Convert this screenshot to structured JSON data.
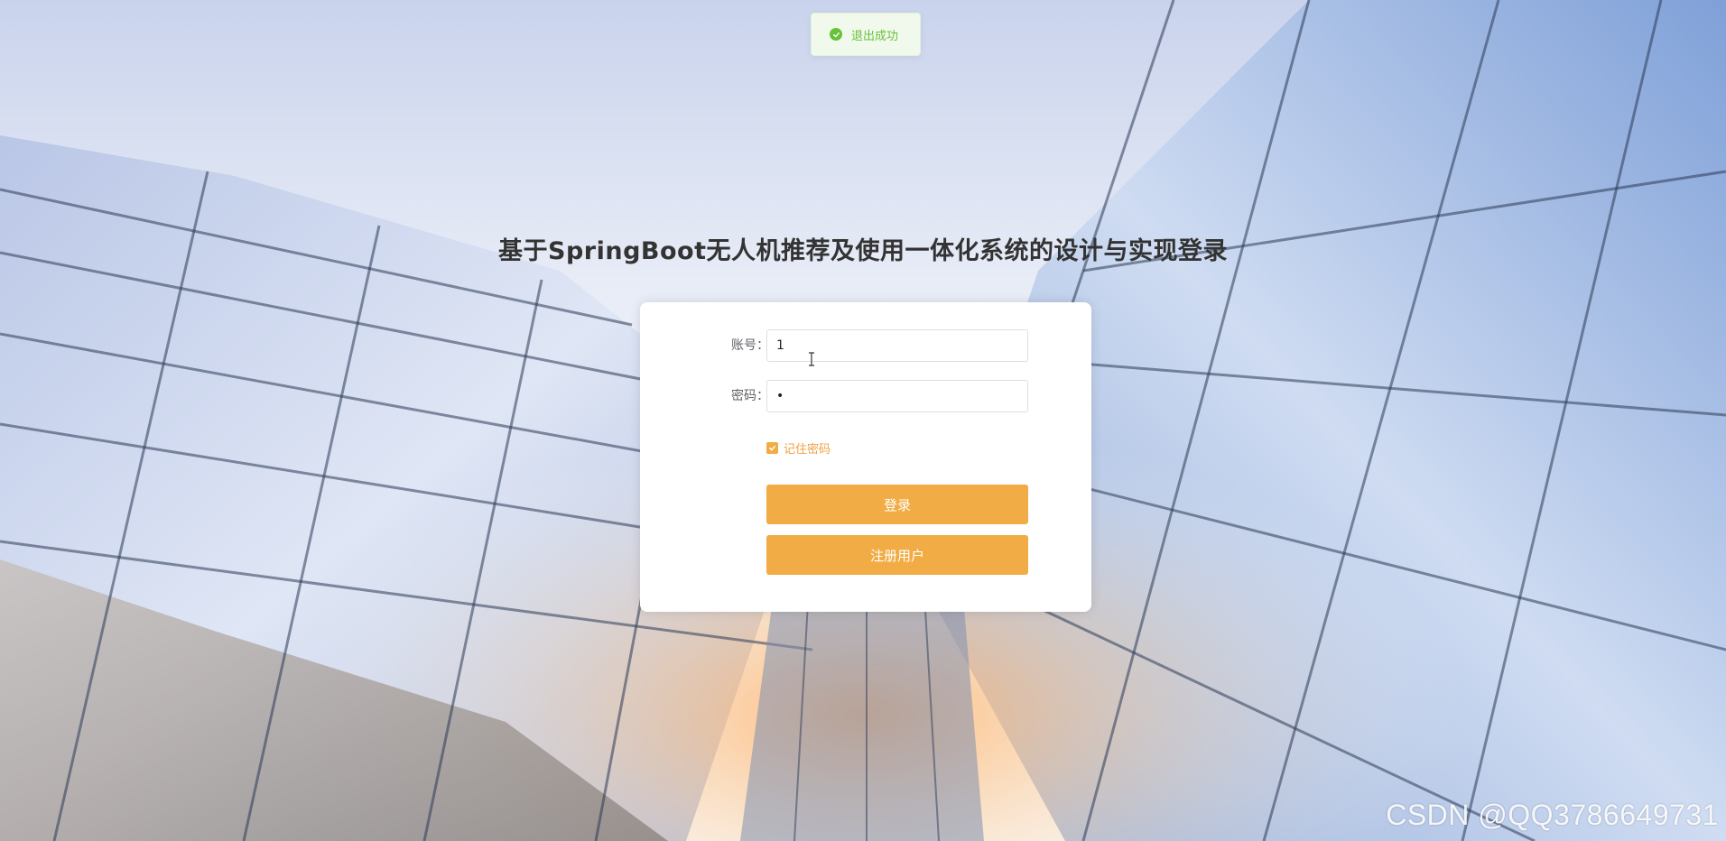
{
  "toast": {
    "text": "退出成功",
    "color": "#67c23a"
  },
  "page_title": "基于SpringBoot无人机推荐及使用一体化系统的设计与实现登录",
  "login_form": {
    "account_label": "账号：",
    "account_value": "1",
    "password_label": "密码：",
    "password_value": "•",
    "remember_label": "记住密码",
    "remember_checked": true,
    "login_button": "登录",
    "register_button": "注册用户",
    "accent_color": "#f1ac45"
  },
  "watermark": "CSDN @QQ3786649731"
}
